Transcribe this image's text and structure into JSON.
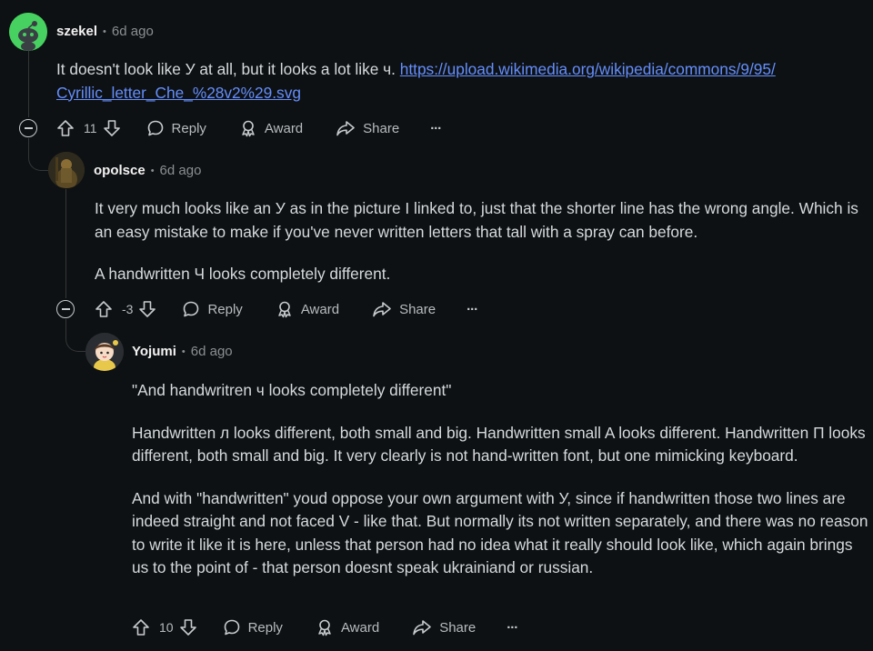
{
  "comments": [
    {
      "author": "szekel",
      "time": "6d ago",
      "text_before_link": "It doesn't look like У at all, but it looks a lot like ч. ",
      "link_line1": "https://upload.wikimedia.org/wikipedia/commons/9/95/",
      "link_line2": "Cyrillic_letter_Che_%28v2%29.svg",
      "score": "11",
      "reply_label": "Reply",
      "award_label": "Award",
      "share_label": "Share",
      "more_label": "···",
      "avatar_color": "#46d160"
    },
    {
      "author": "opolsce",
      "time": "6d ago",
      "paragraphs": [
        "It very much looks like an У as in the picture I linked to, just that the shorter line has the wrong angle. Which is an easy mistake to make if you've never written letters that tall with a spray can before.",
        "A handwritten Ч looks completely different."
      ],
      "score": "-3",
      "reply_label": "Reply",
      "award_label": "Award",
      "share_label": "Share",
      "more_label": "···"
    },
    {
      "author": "Yojumi",
      "time": "6d ago",
      "paragraphs": [
        "\"And handwritren ч looks completely different\"",
        "Handwritten л looks different, both small and big. Handwritten small A looks different. Handwritten П looks different, both small and big. It very clearly is not hand-written font, but one mimicking keyboard.",
        "And with \"handwritten\" youd oppose your own argument with У, since if handwritten those two lines are indeed straight and not faced V - like that. But normally its not written separately, and there was no reason to write it like it is here, unless that person had no idea what it really should look like, which again brings us to the point of - that person doesnt speak ukrainiand or russian."
      ],
      "score": "10",
      "reply_label": "Reply",
      "award_label": "Award",
      "share_label": "Share",
      "more_label": "···"
    }
  ],
  "colors": {
    "background": "#0e1113",
    "link": "#648efc",
    "text": "#d7dadc",
    "muted": "#8b8f91"
  },
  "icons": [
    "upvote-icon",
    "downvote-icon",
    "reply-icon",
    "award-icon",
    "share-icon",
    "more-icon",
    "collapse-icon"
  ]
}
